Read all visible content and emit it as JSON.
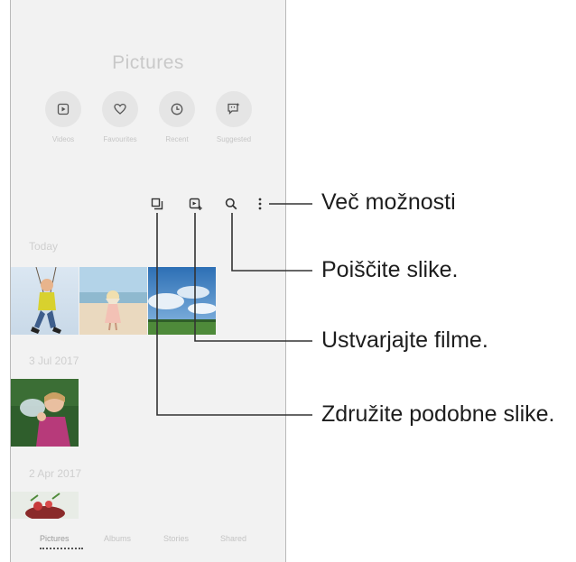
{
  "screen": {
    "title": "Pictures",
    "quick_actions": [
      {
        "label": "Videos",
        "icon": "play-icon"
      },
      {
        "label": "Favourites",
        "icon": "heart-icon"
      },
      {
        "label": "Recent",
        "icon": "clock-icon"
      },
      {
        "label": "Suggested",
        "icon": "suggestion-icon"
      }
    ],
    "toolbar_icons": [
      "group-similar-icon",
      "create-movie-icon",
      "search-icon",
      "more-options-icon"
    ],
    "sections": [
      {
        "date": "Today"
      },
      {
        "date": "3 Jul 2017"
      },
      {
        "date": "2 Apr 2017"
      }
    ],
    "tabs": [
      "Pictures",
      "Albums",
      "Stories",
      "Shared"
    ]
  },
  "callouts": {
    "more_options": "Več možnosti",
    "search": "Poiščite slike.",
    "create_movie": "Ustvarjajte filme.",
    "group_similar": "Združite podobne slike."
  },
  "colors": {
    "screen_background": "#f2f2f2",
    "leader_line": "#333333",
    "callout_text": "#1d1d1d"
  }
}
